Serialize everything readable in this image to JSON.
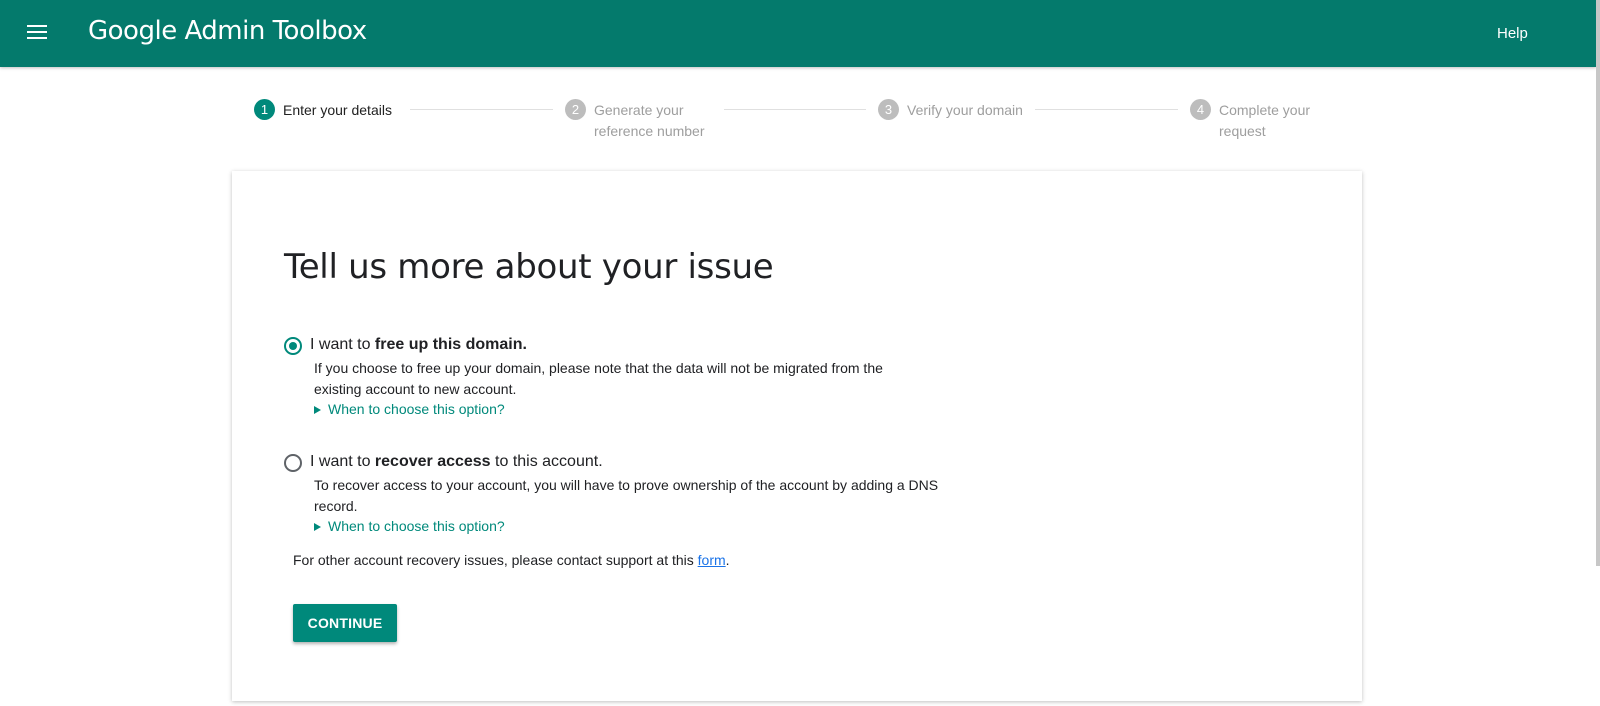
{
  "header": {
    "menu_icon": "menu-icon",
    "title": "Google Admin Toolbox",
    "help_label": "Help",
    "color": "#047a6c"
  },
  "stepper": {
    "active_color": "#00897b",
    "steps": [
      {
        "number": "1",
        "label": "Enter your details",
        "state": "active"
      },
      {
        "number": "2",
        "label": "Generate your reference number",
        "state": "inactive"
      },
      {
        "number": "3",
        "label": "Verify your domain",
        "state": "inactive"
      },
      {
        "number": "4",
        "label": "Complete your request",
        "state": "inactive"
      }
    ]
  },
  "card": {
    "title": "Tell us more about your issue",
    "options": [
      {
        "label_prefix": "I want to ",
        "label_bold": "free up this domain.",
        "label_suffix": "",
        "selected": true,
        "description": "If you choose to free up your domain, please note that the data will not be migrated from the existing account to new account.",
        "toggle_label": "When to choose this option?"
      },
      {
        "label_prefix": "I want to ",
        "label_bold": "recover access",
        "label_suffix": " to this account.",
        "selected": false,
        "description": "To recover access to your account, you will have to prove ownership of the account by adding a DNS record.",
        "toggle_label": "When to choose this option?"
      }
    ],
    "other_issues_prefix": "For other account recovery issues, please contact support at this ",
    "other_issues_link": "form",
    "other_issues_suffix": ".",
    "continue_label": "CONTINUE"
  }
}
